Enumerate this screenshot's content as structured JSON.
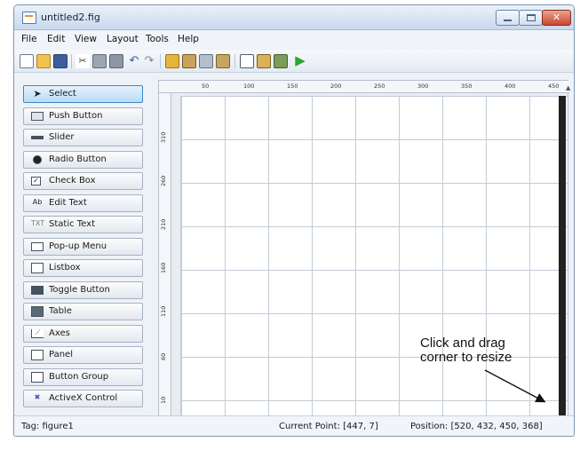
{
  "window": {
    "title": "untitled2.fig"
  },
  "menu": [
    "File",
    "Edit",
    "View",
    "Layout",
    "Tools",
    "Help"
  ],
  "toolbar": {
    "icons": [
      "new-figure-icon",
      "open-file-icon",
      "save-icon",
      "cut-icon",
      "copy-icon",
      "paste-icon",
      "undo-icon",
      "redo-icon",
      "align-objects-icon",
      "menu-editor-icon",
      "tab-order-editor-icon",
      "toolbar-editor-icon",
      "editor-icon",
      "property-inspector-icon",
      "object-browser-icon",
      "run-figure-icon"
    ]
  },
  "palette": {
    "items": [
      {
        "label": "Select",
        "icon": "cursor-arrow-icon",
        "selected": true
      },
      {
        "label": "Push Button",
        "icon": "push-button-icon"
      },
      {
        "label": "Slider",
        "icon": "slider-icon"
      },
      {
        "label": "Radio Button",
        "icon": "radio-button-icon"
      },
      {
        "label": "Check Box",
        "icon": "check-box-icon"
      },
      {
        "label": "Edit Text",
        "icon": "edit-text-icon"
      },
      {
        "label": "Static Text",
        "icon": "static-text-icon"
      },
      {
        "label": "Pop-up Menu",
        "icon": "popup-menu-icon"
      },
      {
        "label": "Listbox",
        "icon": "listbox-icon"
      },
      {
        "label": "Toggle Button",
        "icon": "toggle-button-icon"
      },
      {
        "label": "Table",
        "icon": "table-icon"
      },
      {
        "label": "Axes",
        "icon": "axes-icon"
      },
      {
        "label": "Panel",
        "icon": "panel-icon"
      },
      {
        "label": "Button Group",
        "icon": "button-group-icon"
      },
      {
        "label": "ActiveX Control",
        "icon": "activex-control-icon"
      }
    ]
  },
  "rulers": {
    "horizontal": [
      "50",
      "100",
      "150",
      "200",
      "250",
      "300",
      "350",
      "400",
      "450"
    ],
    "vertical": [
      "310",
      "260",
      "210",
      "160",
      "110",
      "60",
      "10"
    ]
  },
  "annotation": {
    "line1": "Click and drag",
    "line2": "corner to resize"
  },
  "status": {
    "tag": "Tag: figure1",
    "current_point": "Current Point:  [447, 7]",
    "position": "Position: [520, 432, 450, 368]"
  }
}
